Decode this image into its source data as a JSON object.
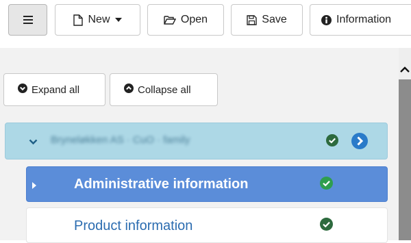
{
  "toolbar": {
    "menu": {
      "icon": "hamburger-icon"
    },
    "new": {
      "label": "New",
      "icon": "file-icon"
    },
    "open": {
      "label": "Open",
      "icon": "folder-open-icon"
    },
    "save": {
      "label": "Save",
      "icon": "floppy-disk-icon"
    },
    "information": {
      "label": "Information",
      "icon": "info-circle-icon"
    }
  },
  "tree_controls": {
    "expand_all": {
      "label": "Expand all",
      "icon": "chevron-circle-down-icon"
    },
    "collapse_all": {
      "label": "Collapse all",
      "icon": "chevron-circle-up-icon"
    }
  },
  "tree": {
    "root": {
      "name": "Bryneløkken AS · CuO · family",
      "blurred": true,
      "status": "complete"
    },
    "children": [
      {
        "label": "Administrative information",
        "selected": true,
        "status": "complete"
      },
      {
        "label": "Product information",
        "selected": false,
        "status": "complete"
      }
    ]
  },
  "colors": {
    "selected_row": "#5b8dd9",
    "root_row": "#add8e6",
    "check_green": "#2f9e4f",
    "check_dark_green": "#2d6a3e",
    "link_blue": "#2b6cb0",
    "go_blue": "#2a7bc9"
  }
}
